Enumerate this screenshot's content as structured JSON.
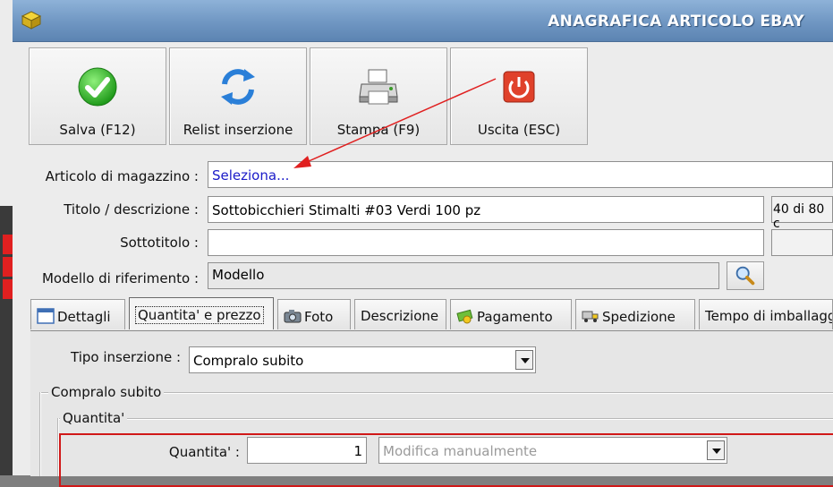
{
  "window": {
    "title": "ANAGRAFICA ARTICOLO EBAY"
  },
  "toolbar": {
    "save_label": "Salva (F12)",
    "relist_label": "Relist inserzione",
    "print_label": "Stampa (F9)",
    "exit_label": "Uscita (ESC)"
  },
  "form": {
    "articolo_label": "Articolo di magazzino :",
    "articolo_value": "Seleziona...",
    "titolo_label": "Titolo / descrizione :",
    "titolo_value": "Sottobicchieri Stimalti #03 Verdi 100 pz",
    "titolo_counter": "40 di 80 c",
    "sottotitolo_label": "Sottotitolo :",
    "sottotitolo_value": "",
    "modello_label": "Modello di riferimento :",
    "modello_value": "Modello"
  },
  "tabs": [
    {
      "label": "Dettagli",
      "icon": "calendar-icon"
    },
    {
      "label": "Quantita' e prezzo",
      "icon": "",
      "active": true
    },
    {
      "label": "Foto",
      "icon": "camera-icon"
    },
    {
      "label": "Descrizione",
      "icon": ""
    },
    {
      "label": "Pagamento",
      "icon": "money-icon"
    },
    {
      "label": "Spedizione",
      "icon": "truck-icon"
    },
    {
      "label": "Tempo di imballagg",
      "icon": ""
    }
  ],
  "panel": {
    "tipo_label": "Tipo inserzione :",
    "tipo_value": "Compralo subito",
    "group_compralo": "Compralo subito",
    "group_quantita": "Quantita'",
    "quantita_label": "Quantita' :",
    "quantita_value": "1",
    "quantita_mode": "Modifica manualmente"
  },
  "colors": {
    "titlebar": "#6f96c2",
    "highlight_border": "#d01818",
    "link_text": "#1a1ac8"
  }
}
